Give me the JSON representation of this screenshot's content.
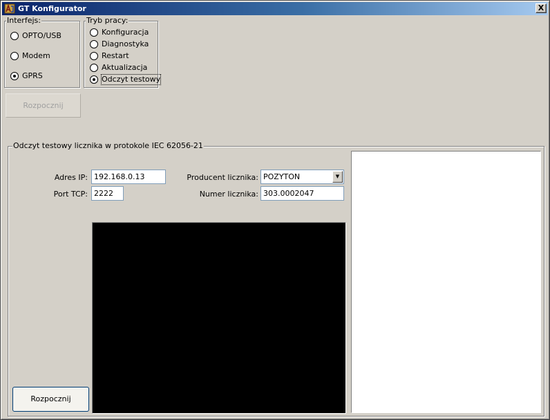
{
  "window": {
    "title": "GT Konfigurator",
    "close_glyph": "X",
    "icon": "app-icon"
  },
  "interface_group": {
    "legend": "Interfejs:",
    "options": [
      {
        "label": "OPTO/USB",
        "checked": false
      },
      {
        "label": "Modem",
        "checked": false
      },
      {
        "label": "GPRS",
        "checked": true
      }
    ]
  },
  "mode_group": {
    "legend": "Tryb pracy:",
    "options": [
      {
        "label": "Konfiguracja",
        "checked": false
      },
      {
        "label": "Diagnostyka",
        "checked": false
      },
      {
        "label": "Restart",
        "checked": false
      },
      {
        "label": "Aktualizacja",
        "checked": false
      },
      {
        "label": "Odczyt testowy",
        "checked": true
      }
    ]
  },
  "top_start_button": {
    "label": "Rozpocznij",
    "enabled": false
  },
  "test_read_group": {
    "legend": "Odczyt testowy licznika w protokole IEC 62056-21",
    "ip_label": "Adres IP:",
    "ip_value": "192.168.0.13",
    "port_label": "Port TCP:",
    "port_value": "2222",
    "manufacturer_label": "Producent licznika:",
    "manufacturer_value": "POZYTON",
    "meter_number_label": "Numer licznika:",
    "meter_number_value": "303.0002047",
    "start_button": "Rozpocznij"
  },
  "colors": {
    "titlebar_start": "#0a246a",
    "titlebar_end": "#a6caf0",
    "face": "#d4d0c8",
    "console": "#000000",
    "output": "#ffffff"
  }
}
